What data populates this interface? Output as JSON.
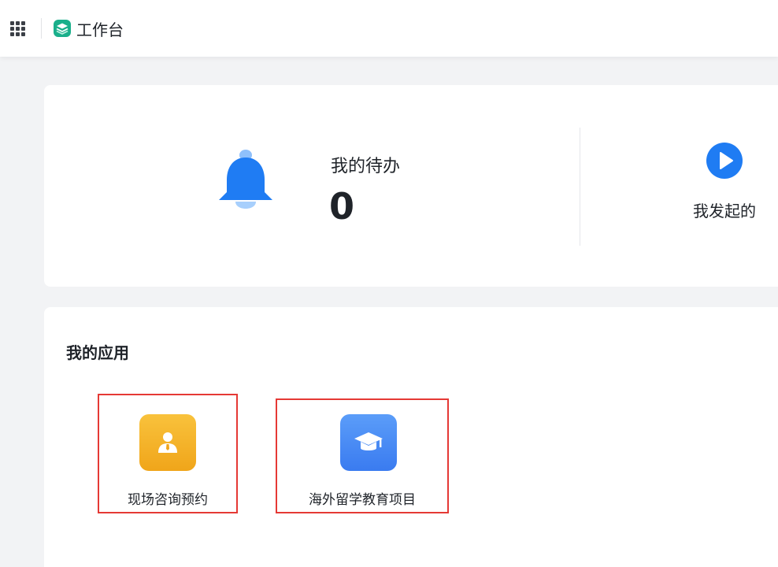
{
  "header": {
    "app_title": "工作台",
    "icons": {
      "menu": "grid-menu-icon",
      "logo": "workbench-logo-icon"
    }
  },
  "todo": {
    "title": "我的待办",
    "count": "0",
    "icon": "bell-icon"
  },
  "initiated": {
    "label": "我发起的",
    "icon": "play-circle-icon"
  },
  "apps": {
    "title": "我的应用",
    "items": [
      {
        "label": "现场咨询预约",
        "icon": "consultant-icon",
        "color": "#f5b52a"
      },
      {
        "label": "海外留学教育项目",
        "icon": "graduation-cap-icon",
        "color": "#4a8cf5"
      }
    ]
  },
  "colors": {
    "accent_blue": "#1f7cf3",
    "highlight_border": "#e53935",
    "logo_green": "#1aaf8b"
  }
}
